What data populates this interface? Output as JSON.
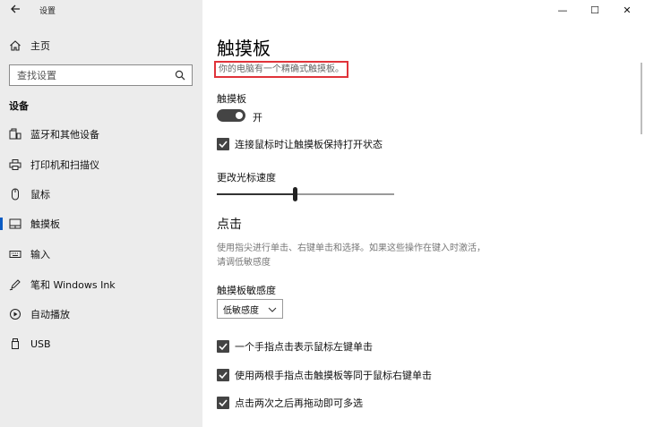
{
  "window": {
    "title": "设置",
    "controls": {
      "minimize": "—",
      "maximize": "☐",
      "close": "✕"
    }
  },
  "sidebar": {
    "home_label": "主页",
    "search": {
      "placeholder": "查找设置"
    },
    "section_title": "设备",
    "items": [
      {
        "label": "蓝牙和其他设备",
        "icon": "bluetooth-devices-icon"
      },
      {
        "label": "打印机和扫描仪",
        "icon": "printer-icon"
      },
      {
        "label": "鼠标",
        "icon": "mouse-icon"
      },
      {
        "label": "触摸板",
        "icon": "touchpad-icon",
        "active": true
      },
      {
        "label": "输入",
        "icon": "keyboard-icon"
      },
      {
        "label": "笔和 Windows Ink",
        "icon": "pen-icon"
      },
      {
        "label": "自动播放",
        "icon": "autoplay-icon"
      },
      {
        "label": "USB",
        "icon": "usb-icon"
      }
    ]
  },
  "main": {
    "title": "触摸板",
    "subtitle": "你的电脑有一个精确式触摸板。",
    "touchpad_label": "触摸板",
    "toggle_state": "开",
    "keep_on_label": "连接鼠标时让触摸板保持打开状态",
    "cursor_speed_label": "更改光标速度",
    "cursor_speed_fraction": 0.44,
    "taps_heading": "点击",
    "taps_description": "使用指尖进行单击、右键单击和选择。如果这些操作在键入时激活，请调低敏感度",
    "sensitivity_label": "触摸板敏感度",
    "sensitivity_value": "低敏感度",
    "checkboxes": [
      "一个手指点击表示鼠标左键单击",
      "使用两根手指点击触摸板等同于鼠标右键单击",
      "点击两次之后再拖动即可多选"
    ]
  }
}
